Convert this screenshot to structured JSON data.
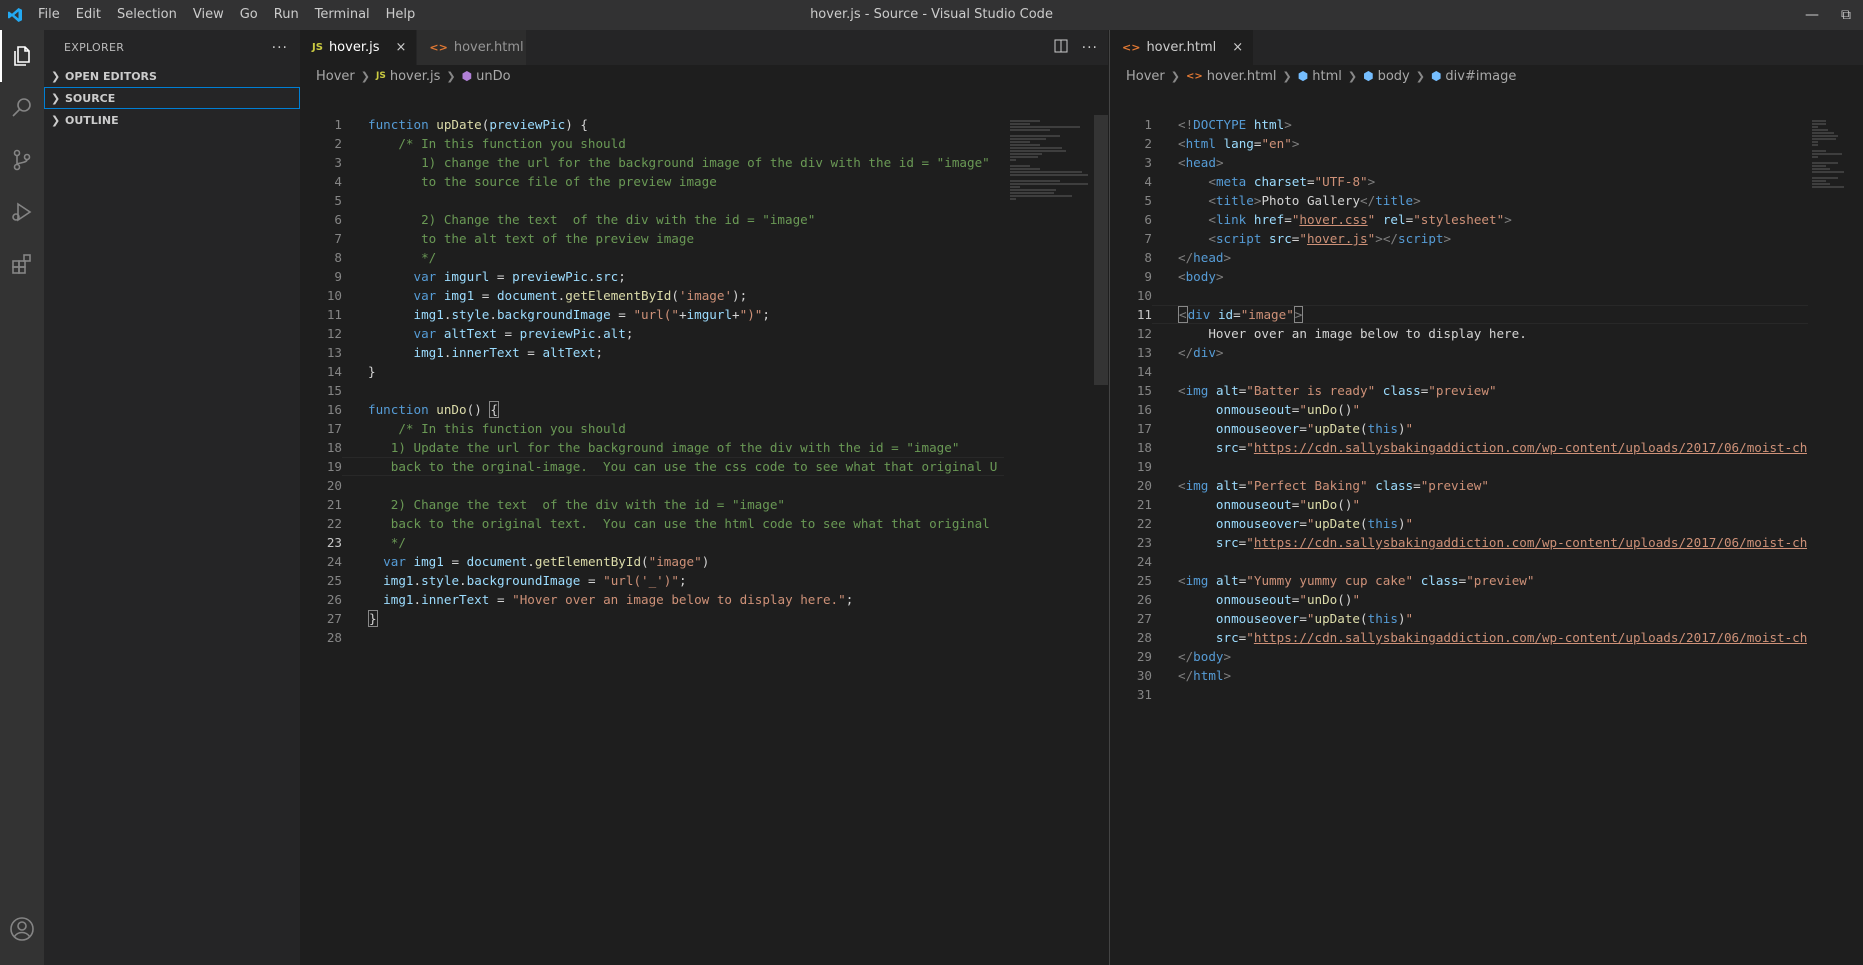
{
  "window": {
    "title": "hover.js - Source - Visual Studio Code",
    "menu": [
      "File",
      "Edit",
      "Selection",
      "View",
      "Go",
      "Run",
      "Terminal",
      "Help"
    ]
  },
  "sidebar": {
    "title": "EXPLORER",
    "more": "···",
    "sections": [
      "OPEN EDITORS",
      "SOURCE",
      "OUTLINE"
    ]
  },
  "left_editor": {
    "tabs": [
      {
        "icon": "JS",
        "label": "hover.js",
        "close": "×"
      },
      {
        "icon": "<>",
        "label": "hover.html"
      }
    ],
    "breadcrumb": [
      "Hover",
      "hover.js",
      "unDo"
    ]
  },
  "right_editor": {
    "tabs": [
      {
        "icon": "<>",
        "label": "hover.html",
        "close": "×"
      }
    ],
    "breadcrumb": [
      "Hover",
      "hover.html",
      "html",
      "body",
      "div#image"
    ]
  }
}
